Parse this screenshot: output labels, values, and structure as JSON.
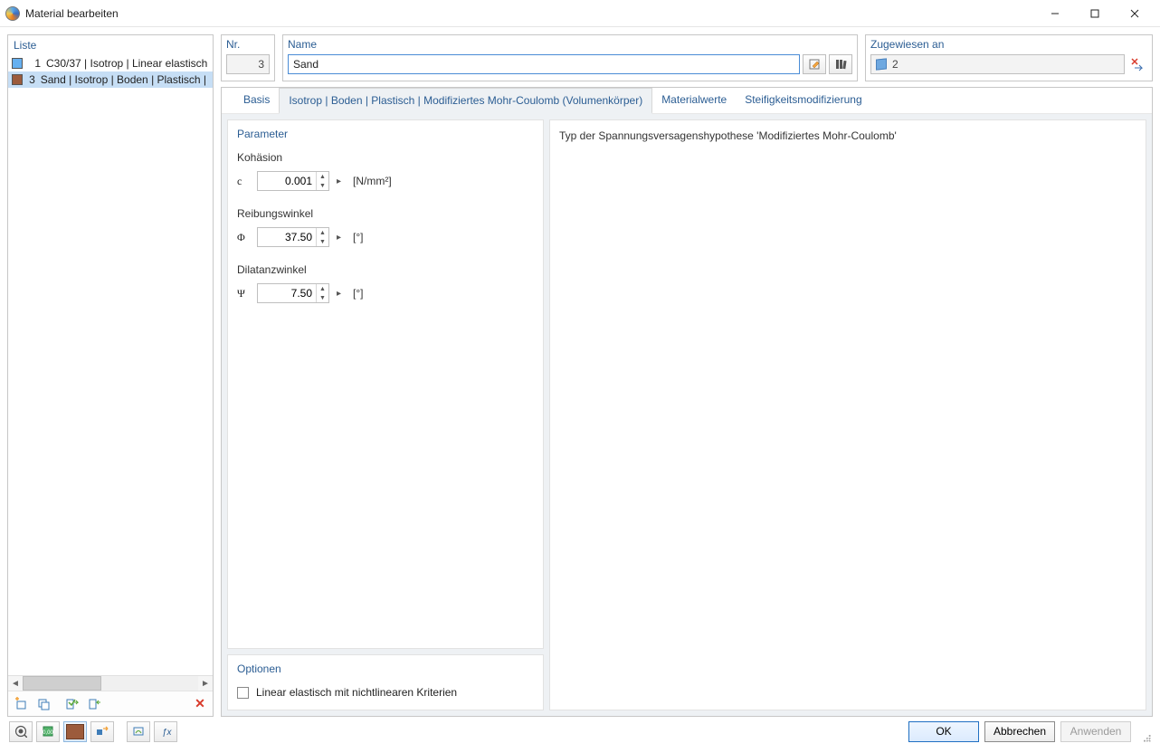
{
  "window": {
    "title": "Material bearbeiten"
  },
  "left": {
    "header": "Liste",
    "items": [
      {
        "idx": "1",
        "text": "C30/37 | Isotrop | Linear elastisch",
        "color": "blue",
        "selected": false
      },
      {
        "idx": "3",
        "text": "Sand | Isotrop | Boden | Plastisch | Modifiziertes Mohr-Coulomb",
        "color": "brown",
        "selected": true
      }
    ]
  },
  "header": {
    "nr": {
      "label": "Nr.",
      "value": "3"
    },
    "name": {
      "label": "Name",
      "value": "Sand"
    },
    "assigned": {
      "label": "Zugewiesen an",
      "value": "2"
    }
  },
  "tabs": [
    "Basis",
    "Isotrop | Boden | Plastisch | Modifiziertes Mohr-Coulomb (Volumenkörper)",
    "Materialwerte",
    "Steifigkeitsmodifizierung"
  ],
  "activeTab": 1,
  "params": {
    "title": "Parameter",
    "items": [
      {
        "label": "Kohäsion",
        "symbol": "c",
        "value": "0.001",
        "unit": "[N/mm²]"
      },
      {
        "label": "Reibungswinkel",
        "symbol": "Φ",
        "value": "37.50",
        "unit": "[°]"
      },
      {
        "label": "Dilatanzwinkel",
        "symbol": "Ψ",
        "value": "7.50",
        "unit": "[°]"
      }
    ]
  },
  "options": {
    "title": "Optionen",
    "checkbox": "Linear elastisch mit nichtlinearen Kriterien"
  },
  "description": "Typ der Spannungsversagenshypothese 'Modifiziertes Mohr-Coulomb'",
  "buttons": {
    "ok": "OK",
    "cancel": "Abbrechen",
    "apply": "Anwenden"
  }
}
